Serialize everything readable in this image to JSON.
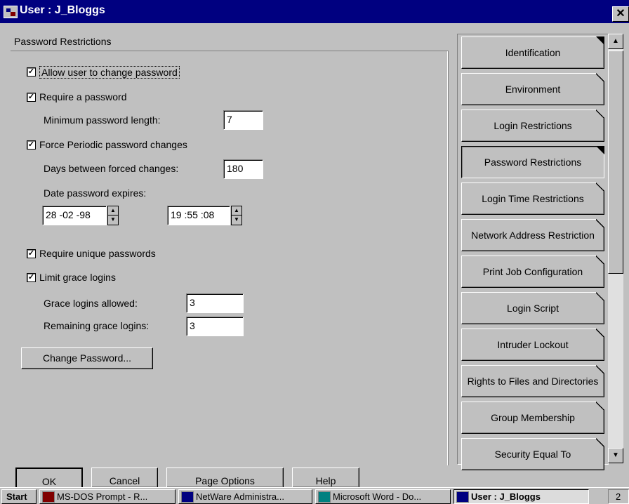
{
  "window": {
    "title": "User : J_Bloggs",
    "close_glyph": "✕"
  },
  "group": {
    "label": "Password Restrictions"
  },
  "options": {
    "allow_change": {
      "label": "Allow user to change password",
      "checked": true
    },
    "require_password": {
      "label": "Require a password",
      "checked": true
    },
    "min_length": {
      "label": "Minimum password length:",
      "value": "7"
    },
    "force_periodic": {
      "label": "Force Periodic password changes",
      "checked": true
    },
    "days_between": {
      "label": "Days between forced changes:",
      "value": "180"
    },
    "date_expires": {
      "label": "Date password expires:",
      "date": "28 -02 -98",
      "time": "19 :55 :08"
    },
    "require_unique": {
      "label": "Require unique passwords",
      "checked": true
    },
    "limit_grace": {
      "label": "Limit grace logins",
      "checked": true
    },
    "grace_allowed": {
      "label": "Grace logins allowed:",
      "value": "3"
    },
    "grace_remaining": {
      "label": "Remaining grace logins:",
      "value": "3"
    },
    "change_password_button": "Change Password..."
  },
  "check_glyph": "✓",
  "tabs": [
    {
      "label": "Identification",
      "active": false
    },
    {
      "label": "Environment",
      "active": false
    },
    {
      "label": "Login Restrictions",
      "active": false
    },
    {
      "label": "Password Restrictions",
      "active": true
    },
    {
      "label": "Login Time Restrictions",
      "active": false
    },
    {
      "label": "Network Address Restriction",
      "active": false
    },
    {
      "label": "Print Job Configuration",
      "active": false
    },
    {
      "label": "Login Script",
      "active": false
    },
    {
      "label": "Intruder Lockout",
      "active": false
    },
    {
      "label": "Rights to Files and Directories",
      "active": false
    },
    {
      "label": "Group Membership",
      "active": false
    },
    {
      "label": "Security Equal To",
      "active": false
    }
  ],
  "bottom_buttons": {
    "ok": "OK",
    "cancel": "Cancel",
    "page_options": "Page Options",
    "help": "Help"
  },
  "taskbar": {
    "start": "Start",
    "tasks": [
      {
        "label": "MS-DOS Prompt - R...",
        "icon": "msdos-icon"
      },
      {
        "label": "NetWare Administra...",
        "icon": "netware-icon"
      },
      {
        "label": "Microsoft Word - Do...",
        "icon": "word-icon"
      },
      {
        "label": "User : J_Bloggs",
        "icon": "user-window-icon"
      }
    ],
    "tray": "2"
  }
}
